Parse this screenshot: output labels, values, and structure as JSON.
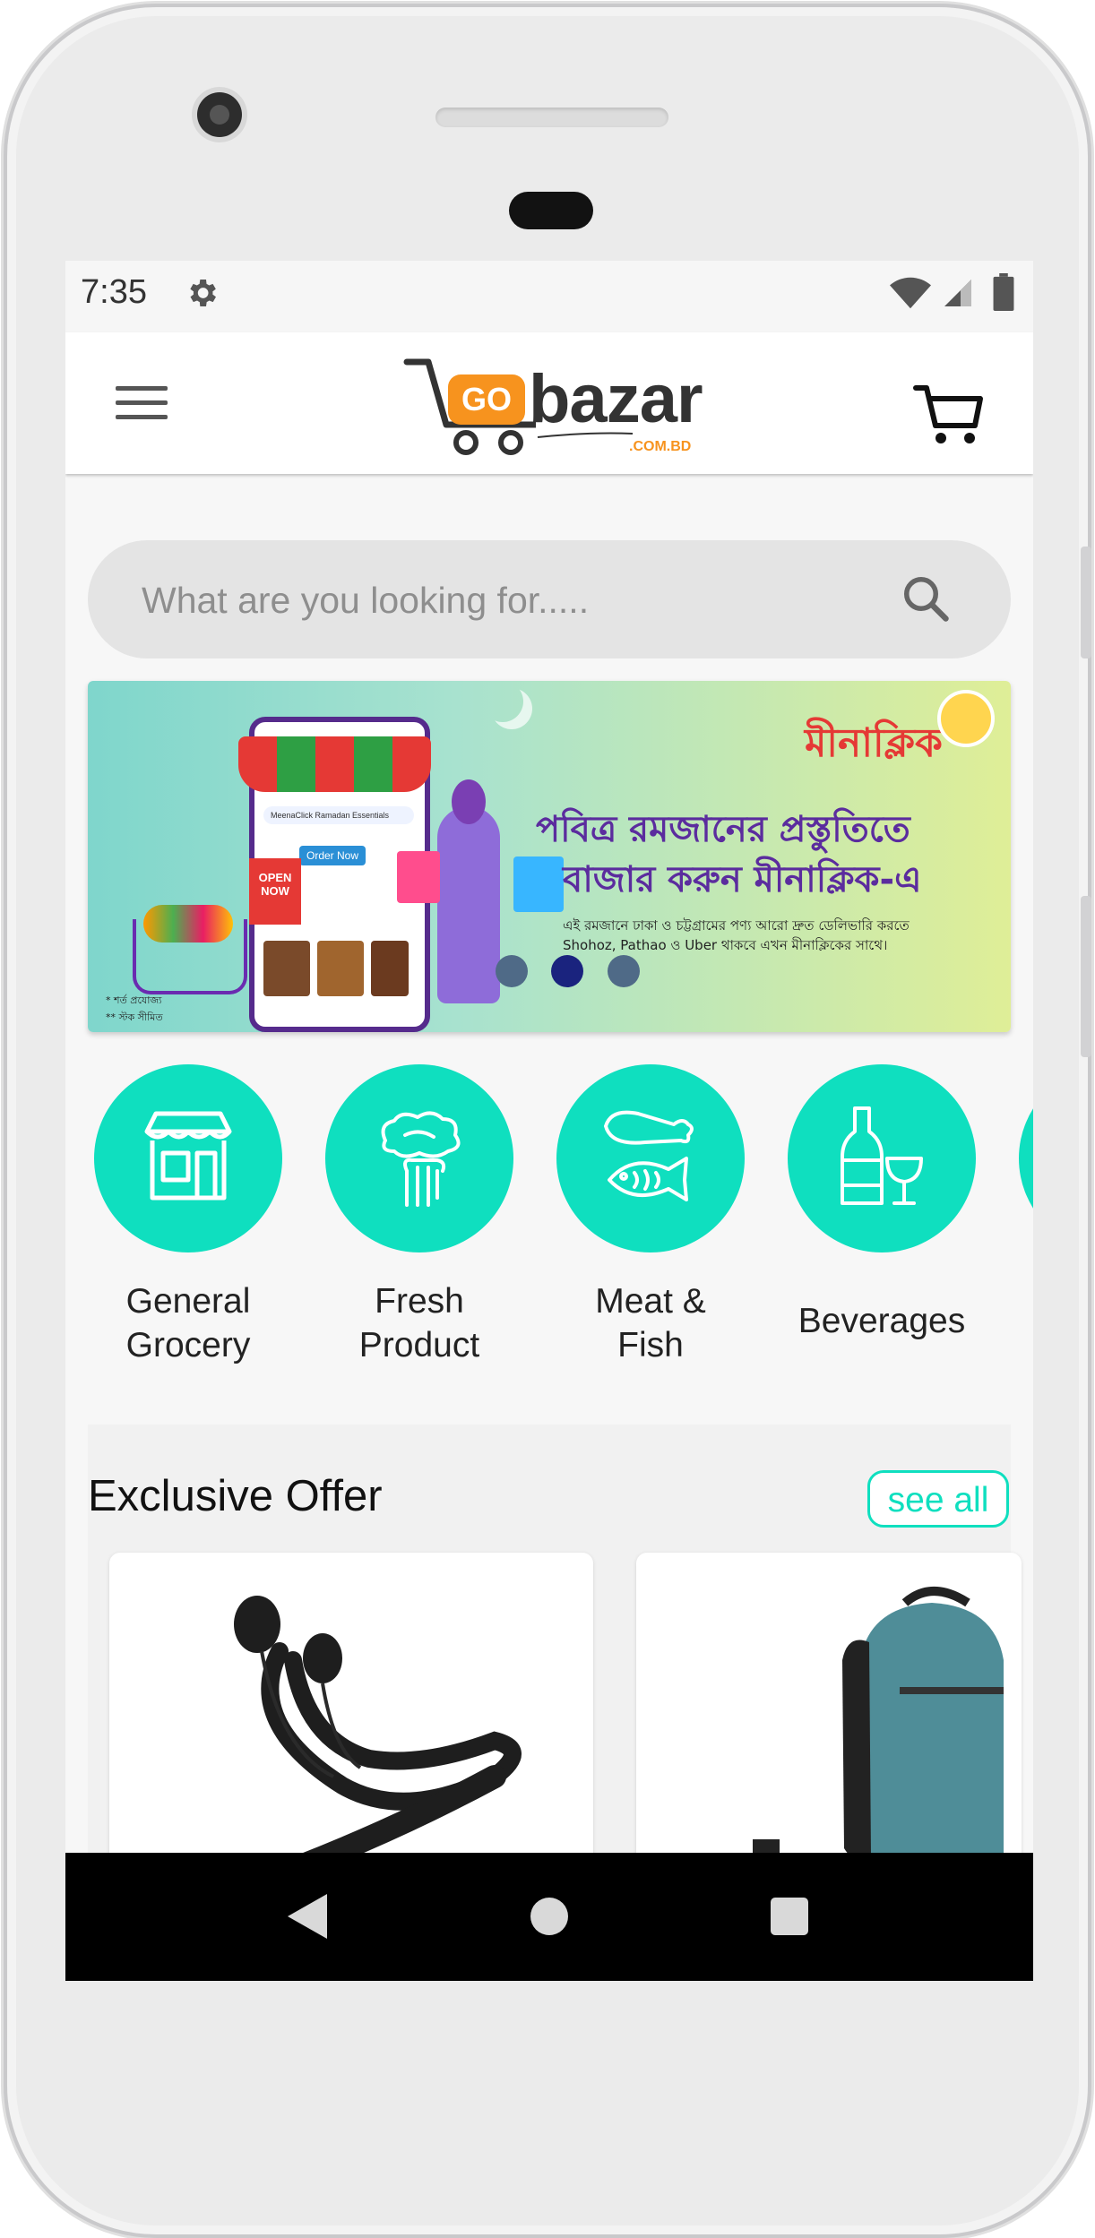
{
  "status_bar": {
    "time": "7:35",
    "icons": [
      "gear-icon",
      "wifi-icon",
      "cellular-signal-icon",
      "battery-icon"
    ]
  },
  "app_bar": {
    "logo_badge": "GO",
    "logo_text": "bazar",
    "logo_domain": ".COM.BD",
    "icons": [
      "hamburger-menu-icon",
      "shopping-cart-icon"
    ]
  },
  "search": {
    "placeholder": "What are you looking for.....",
    "icon": "search-icon"
  },
  "banner": {
    "brand": "মীনাক্লিক",
    "headline_line1": "পবিত্র রমজানের প্রস্তুতিতে",
    "headline_line2": "বাজার করুন মীনাক্লিক-এ",
    "subtext_line1": "এই রমজানে ঢাকা ও চট্টগ্রামের পণ্য আরো দ্রুত ডেলিভারি করতে",
    "subtext_line2": "Shohoz, Pathao ও Uber থাকবে এখন মীনাক্লিকের সাথে।",
    "phone_search_text": "MeenaClick Ramadan Essentials",
    "order_button": "Order Now",
    "open_tag_line1": "OPEN",
    "open_tag_line2": "NOW",
    "footnote_line1": "* শর্ত প্রযোজ্য",
    "footnote_line2": "** স্টক সীমিত",
    "carousel": {
      "count": 3,
      "active_index": 1
    }
  },
  "categories": [
    {
      "label_line1": "General",
      "label_line2": "Grocery",
      "icon": "storefront-icon"
    },
    {
      "label_line1": "Fresh",
      "label_line2": "Product",
      "icon": "vegetable-in-hand-icon"
    },
    {
      "label_line1": "Meat &",
      "label_line2": "Fish",
      "icon": "meat-and-fish-icon"
    },
    {
      "label_line1": "Beverages",
      "label_line2": "",
      "icon": "bottle-and-glass-icon"
    }
  ],
  "exclusive_offer": {
    "title": "Exclusive Offer",
    "see_all": "see all",
    "products": [
      {
        "image": "neckband-earphones-image"
      },
      {
        "image": "backpack-image"
      }
    ]
  },
  "colors": {
    "accent": "#0fdfbf",
    "logo_orange": "#f7931e",
    "nav_bar": "#000000",
    "search_bg": "#e4e4e4"
  },
  "navigation_bar": {
    "icons": [
      "back-icon",
      "home-icon",
      "recent-apps-icon"
    ]
  }
}
